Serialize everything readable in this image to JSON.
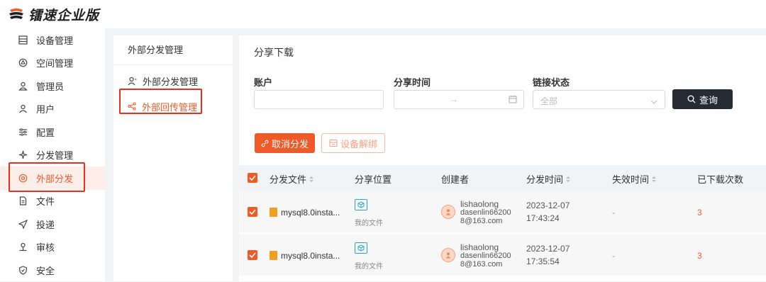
{
  "app": {
    "logo_text": "镭速企业版"
  },
  "sidebar": {
    "items": [
      {
        "label": "设备管理",
        "icon": "device-icon"
      },
      {
        "label": "空间管理",
        "icon": "space-icon"
      },
      {
        "label": "管理员",
        "icon": "admin-icon"
      },
      {
        "label": "用户",
        "icon": "user-icon"
      },
      {
        "label": "配置",
        "icon": "config-icon"
      },
      {
        "label": "分发管理",
        "icon": "distribute-icon"
      },
      {
        "label": "外部分发",
        "icon": "external-share-icon",
        "active": true
      },
      {
        "label": "文件",
        "icon": "file-icon"
      },
      {
        "label": "投递",
        "icon": "send-icon"
      },
      {
        "label": "审核",
        "icon": "audit-icon"
      },
      {
        "label": "安全",
        "icon": "shield-icon"
      }
    ]
  },
  "subnav": {
    "title": "外部分发管理",
    "items": [
      {
        "label": "外部分发管理",
        "icon": "user-share-icon"
      },
      {
        "label": "外部回传管理",
        "icon": "share-icon",
        "active": true
      }
    ]
  },
  "main": {
    "title": "分享下载",
    "filters": {
      "account_label": "账户",
      "account_value": "",
      "time_label": "分享时间",
      "time_separator": "→",
      "status_label": "链接状态",
      "status_placeholder": "全部",
      "search_label": "查询"
    },
    "actions": {
      "cancel_label": "取消分发",
      "unbind_label": "设备解绑"
    },
    "table": {
      "columns": [
        "分发文件",
        "分享位置",
        "创建者",
        "分发时间",
        "失效时间",
        "已下载次数"
      ],
      "rows": [
        {
          "file": "mysql8.0insta...",
          "location": "我的文件",
          "creator_name": "lishaolong",
          "creator_email_1": "dasenlin66200",
          "creator_email_2": "8@163.com",
          "date": "2023-12-07",
          "time": "17:43:24",
          "expire": "-",
          "downloads": "3"
        },
        {
          "file": "mysql8.0insta...",
          "location": "我的文件",
          "creator_name": "lishaolong",
          "creator_email_1": "dasenlin66200",
          "creator_email_2": "8@163.com",
          "date": "2023-12-07",
          "time": "17:35:54",
          "expire": "-",
          "downloads": "3"
        }
      ]
    }
  },
  "colors": {
    "accent": "#f05a28",
    "highlight_box": "#e8301c",
    "search_button": "#262a33"
  }
}
